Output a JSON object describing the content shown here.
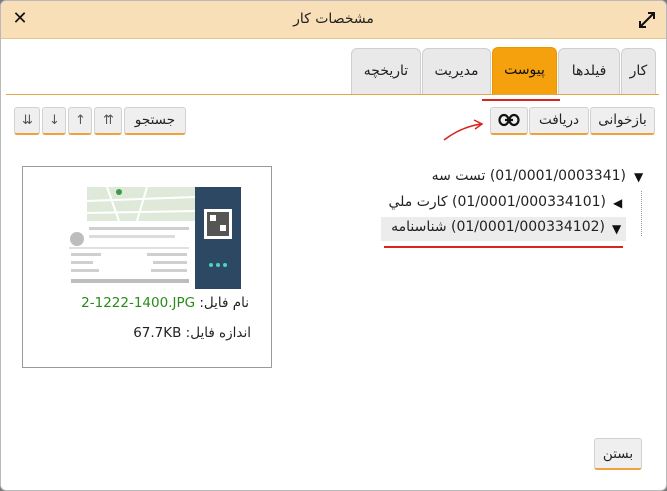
{
  "dialog": {
    "title": "مشخصات کار",
    "close_symbol": "✕",
    "close_label": "بستن"
  },
  "tabs": [
    {
      "label": "کار"
    },
    {
      "label": "فیلدها"
    },
    {
      "label": "پیوست"
    },
    {
      "label": "مدیریت"
    },
    {
      "label": "تاریخچه"
    }
  ],
  "active_tab": "پیوست",
  "toolbar": {
    "reload_label": "بازخوانی",
    "download_label": "دریافت",
    "link_icon": "link-icon",
    "search_label": "جستجو",
    "move_top_symbol": "⇈",
    "move_up_symbol": "↑",
    "move_down_symbol": "↓",
    "move_bottom_symbol": "⇊"
  },
  "preview": {
    "file_name_label": "نام فایل:",
    "file_name": "2-1222-1400.JPG",
    "file_size_label": "اندازه فایل:",
    "file_size": "67.7KB"
  },
  "tree": [
    {
      "label": "(01/0001/0003341) تست سه",
      "expanded": true,
      "arrow": "▼"
    },
    {
      "label": "(01/0001/000334101) کارت ملي",
      "expanded": false,
      "arrow": "◀"
    },
    {
      "label": "(01/0001/000334102) شناسنامه",
      "expanded": true,
      "selected": true,
      "arrow": "▼"
    }
  ],
  "colors": {
    "titlebar": "#f8dfb8",
    "accent_tab": "#f5a10e",
    "annotation_red": "#d9251c",
    "file_name_green": "#2a8a1a"
  }
}
